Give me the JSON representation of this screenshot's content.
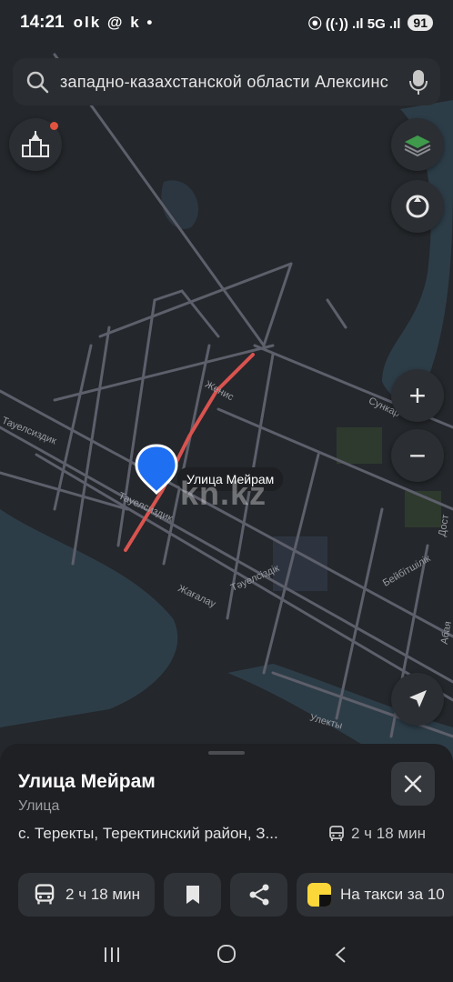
{
  "status_bar": {
    "time": "14:21",
    "left_icons": "olk @ k •",
    "right_icons": "⦿ ((·)) .ıl 5G .ıl",
    "battery": "91"
  },
  "search": {
    "query": "западно-казахстанской области Алексинс"
  },
  "map": {
    "pin_label": "Улица Мейрам",
    "watermark": "kn.kz",
    "street_labels": {
      "zhenis": "Женис",
      "sunkar": "Сункар",
      "tauelsizdik_1": "Тауелсиздик",
      "tauelsizdik_2": "Тауелсиздик",
      "tauelsizdik_3": "Тәуелсіздік",
      "zhagalau": "Жағалау",
      "beibitshilik": "Бейбітшілік",
      "ulekty": "Улекты",
      "dost": "Дост",
      "abai": "Абая"
    },
    "colors": {
      "background": "#24272b",
      "water": "#2d3d48",
      "road": "#5d5f6b",
      "route": "#d9534f",
      "pin": "#1e6ff2"
    }
  },
  "sheet": {
    "title": "Улица Мейрам",
    "type": "Улица",
    "address": "с. Теректы, Теректинский район, З...",
    "eta": "2 ч 18 мин",
    "actions": {
      "route_label": "2 ч 18 мин",
      "taxi_label": "На такси за 10"
    }
  },
  "icons": {
    "search": "search-icon",
    "mic": "mic-icon",
    "landmarks": "city-landmarks-icon",
    "layers": "layers-icon",
    "compass": "compass-icon",
    "zoom_in": "plus-icon",
    "zoom_out": "minus-icon",
    "locate": "locate-arrow-icon",
    "close": "close-icon",
    "bus": "bus-icon",
    "bookmark": "bookmark-icon",
    "share": "share-icon"
  }
}
